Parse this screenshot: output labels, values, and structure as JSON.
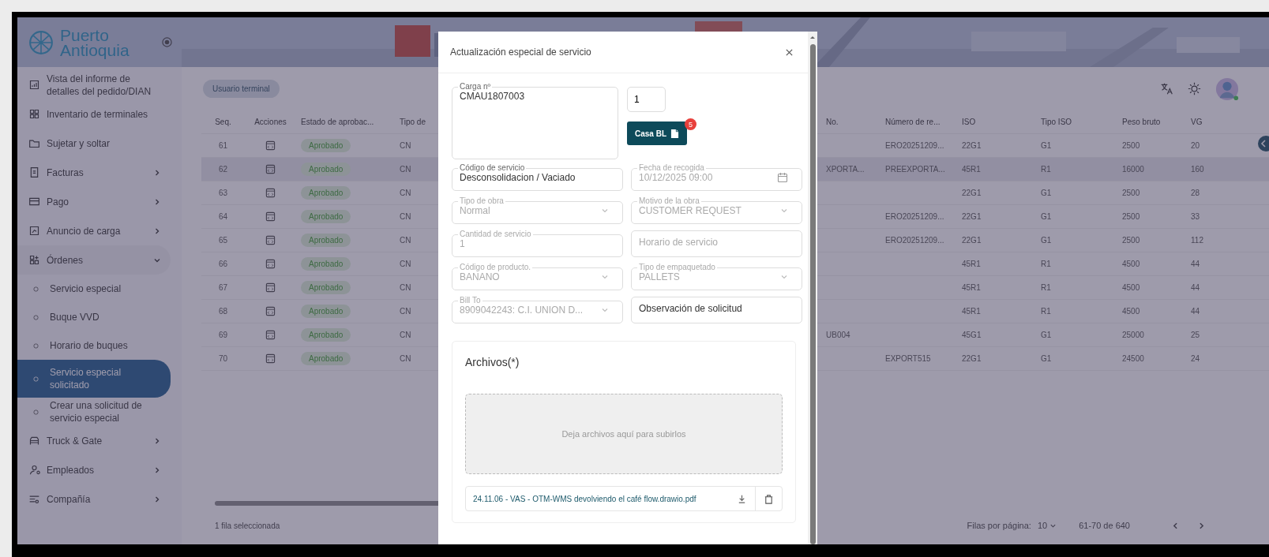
{
  "brand": {
    "line_1": "Puerto",
    "line_2": "Antioquia"
  },
  "sidebar": {
    "items": [
      {
        "label": "Vista del informe de detalles del pedido/DIAN",
        "expandable": false,
        "selected": false
      },
      {
        "label": "Inventario de terminales",
        "expandable": false,
        "selected": false
      },
      {
        "label": "Sujetar y soltar",
        "expandable": false,
        "selected": false
      },
      {
        "label": "Facturas",
        "expandable": true,
        "expanded": false,
        "selected": false
      },
      {
        "label": "Pago",
        "expandable": true,
        "expanded": false,
        "selected": false
      },
      {
        "label": "Anuncio de carga",
        "expandable": true,
        "expanded": false,
        "selected": false
      },
      {
        "label": "Órdenes",
        "expandable": true,
        "expanded": true,
        "selected": false,
        "children": [
          {
            "label": "Servicio especial",
            "selected": false
          },
          {
            "label": "Buque VVD",
            "selected": false
          },
          {
            "label": "Horario de buques",
            "selected": false
          },
          {
            "label": "Servicio especial solicitado",
            "selected": true
          },
          {
            "label": "Crear una solicitud de servicio especial",
            "selected": false
          }
        ]
      },
      {
        "label": "Truck & Gate",
        "expandable": true,
        "expanded": false,
        "selected": false
      },
      {
        "label": "Empleados",
        "expandable": true,
        "expanded": false,
        "selected": false
      },
      {
        "label": "Compañía",
        "expandable": true,
        "expanded": false,
        "selected": false
      }
    ]
  },
  "toolbar": {
    "role_chip": "Usuario terminal"
  },
  "table": {
    "columns_before_dialog": [
      "Seq.",
      "Acciones",
      "Estado de aprobac...",
      "Tipo de"
    ],
    "columns_after_dialog": [
      "No.",
      "Número de re...",
      "ISO",
      "Tipo ISO",
      "Peso bruto",
      "VG"
    ],
    "rows": [
      {
        "seq": "61",
        "status": "Aprobado",
        "type": "CN",
        "selected": false,
        "reference": "ERO20251209...",
        "iso": "22G1",
        "iso_type": "G1",
        "gross_weight": "2500",
        "vg": "20"
      },
      {
        "seq": "62",
        "status": "Aprobado",
        "type": "CN",
        "selected": true,
        "no": "XPORTA...",
        "reference": "PREEXPORTA...",
        "iso": "45R1",
        "iso_type": "R1",
        "gross_weight": "16000",
        "vg": "160"
      },
      {
        "seq": "63",
        "status": "Aprobado",
        "type": "CN",
        "selected": false,
        "iso": "22G1",
        "iso_type": "G1",
        "gross_weight": "2500",
        "vg": "28"
      },
      {
        "seq": "64",
        "status": "Aprobado",
        "type": "CN",
        "selected": false,
        "reference": "ERO20251209...",
        "iso": "22G1",
        "iso_type": "G1",
        "gross_weight": "2500",
        "vg": "33"
      },
      {
        "seq": "65",
        "status": "Aprobado",
        "type": "CN",
        "selected": false,
        "reference": "ERO20251209...",
        "iso": "22G1",
        "iso_type": "G1",
        "gross_weight": "2500",
        "vg": "112"
      },
      {
        "seq": "66",
        "status": "Aprobado",
        "type": "CN",
        "selected": false,
        "iso": "45R1",
        "iso_type": "R1",
        "gross_weight": "4500",
        "vg": "44"
      },
      {
        "seq": "67",
        "status": "Aprobado",
        "type": "CN",
        "selected": false,
        "iso": "45R1",
        "iso_type": "R1",
        "gross_weight": "4500",
        "vg": "44"
      },
      {
        "seq": "68",
        "status": "Aprobado",
        "type": "CN",
        "selected": false,
        "iso": "45R1",
        "iso_type": "R1",
        "gross_weight": "4500",
        "vg": "44"
      },
      {
        "seq": "69",
        "status": "Aprobado",
        "type": "CN",
        "selected": false,
        "no": "UB004",
        "iso": "45G1",
        "iso_type": "G1",
        "gross_weight": "25000",
        "vg": "25"
      },
      {
        "seq": "70",
        "status": "Aprobado",
        "type": "CN",
        "selected": false,
        "reference": "EXPORT515",
        "iso": "22G1",
        "iso_type": "G1",
        "gross_weight": "24500",
        "vg": "24"
      }
    ]
  },
  "footer": {
    "selection": "1 fila seleccionada",
    "rows_per_page_label": "Filas por página:",
    "rows_per_page": "10",
    "range": "61-70 de 640"
  },
  "dialog": {
    "title": "Actualización especial de servicio",
    "cargo": {
      "label": "Carga nº",
      "value": "CMAU1807003"
    },
    "count_field": {
      "value": "1"
    },
    "house_bl_button": {
      "label": "Casa BL",
      "badge": "5"
    },
    "fields": [
      {
        "kind": "text",
        "label": "Código de servicio",
        "value": "Desconsolidacion / Vaciado",
        "disabled": false
      },
      {
        "kind": "date",
        "label": "Fecha de recogida",
        "value": "10/12/2025 09:00",
        "disabled": true
      },
      {
        "kind": "select",
        "label": "Tipo de obra",
        "value": "Normal",
        "disabled": true
      },
      {
        "kind": "select",
        "label": "Motivo de la obra",
        "value": "CUSTOMER REQUEST",
        "disabled": true
      },
      {
        "kind": "text",
        "label": "Cantidad de servicio",
        "value": "1",
        "disabled": true
      },
      {
        "kind": "text",
        "placeholder": "Horario de servicio",
        "disabled": true
      },
      {
        "kind": "select",
        "label": "Código de producto.",
        "value": "BANANO",
        "disabled": true
      },
      {
        "kind": "select",
        "label": "Tipo de empaquetado",
        "value": "PALLETS",
        "disabled": true
      },
      {
        "kind": "select",
        "label": "Bill To",
        "value": "8909042243: C.I. UNION D...",
        "disabled": true
      },
      {
        "kind": "text",
        "placeholder": "Observación de solicitud",
        "disabled": false
      }
    ],
    "files": {
      "title": "Archivos(*)",
      "dropzone": "Deja archivos aquí para subirlos",
      "items": [
        {
          "name": "24.11.06 - VAS - OTM-WMS devolviendo el café flow.drawio.pdf"
        }
      ]
    }
  }
}
